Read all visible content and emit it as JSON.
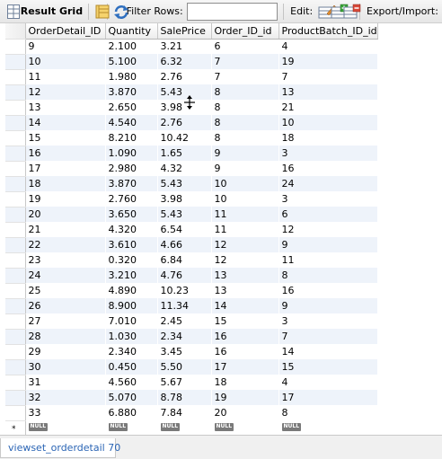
{
  "toolbar": {
    "title": "Result Grid",
    "filter_label": "Filter Rows:",
    "filter_value": "",
    "edit_label": "Edit:",
    "export_label": "Export/Import:"
  },
  "grid": {
    "columns": [
      "OrderDetail_ID",
      "Quantity",
      "SalePrice",
      "Order_ID_id",
      "ProductBatch_ID_id"
    ],
    "rows": [
      [
        "9",
        "2.100",
        "3.21",
        "6",
        "4"
      ],
      [
        "10",
        "5.100",
        "6.32",
        "7",
        "19"
      ],
      [
        "11",
        "1.980",
        "2.76",
        "7",
        "7"
      ],
      [
        "12",
        "3.870",
        "5.43",
        "8",
        "13"
      ],
      [
        "13",
        "2.650",
        "3.98",
        "8",
        "21"
      ],
      [
        "14",
        "4.540",
        "2.76",
        "8",
        "10"
      ],
      [
        "15",
        "8.210",
        "10.42",
        "8",
        "18"
      ],
      [
        "16",
        "1.090",
        "1.65",
        "9",
        "3"
      ],
      [
        "17",
        "2.980",
        "4.32",
        "9",
        "16"
      ],
      [
        "18",
        "3.870",
        "5.43",
        "10",
        "24"
      ],
      [
        "19",
        "2.760",
        "3.98",
        "10",
        "3"
      ],
      [
        "20",
        "3.650",
        "5.43",
        "11",
        "6"
      ],
      [
        "21",
        "4.320",
        "6.54",
        "11",
        "12"
      ],
      [
        "22",
        "3.610",
        "4.66",
        "12",
        "9"
      ],
      [
        "23",
        "0.320",
        "6.84",
        "12",
        "11"
      ],
      [
        "24",
        "3.210",
        "4.76",
        "13",
        "8"
      ],
      [
        "25",
        "4.890",
        "10.23",
        "13",
        "16"
      ],
      [
        "26",
        "8.900",
        "11.34",
        "14",
        "9"
      ],
      [
        "27",
        "7.010",
        "2.45",
        "15",
        "3"
      ],
      [
        "28",
        "1.030",
        "2.34",
        "16",
        "7"
      ],
      [
        "29",
        "2.340",
        "3.45",
        "16",
        "14"
      ],
      [
        "30",
        "0.450",
        "5.50",
        "17",
        "15"
      ],
      [
        "31",
        "4.560",
        "5.67",
        "18",
        "4"
      ],
      [
        "32",
        "5.070",
        "8.78",
        "19",
        "17"
      ],
      [
        "33",
        "6.880",
        "7.84",
        "20",
        "8"
      ]
    ],
    "new_row_marker": "*",
    "null_label": "NULL"
  },
  "tabs": [
    {
      "label": "viewset_orderdetail 70"
    }
  ]
}
